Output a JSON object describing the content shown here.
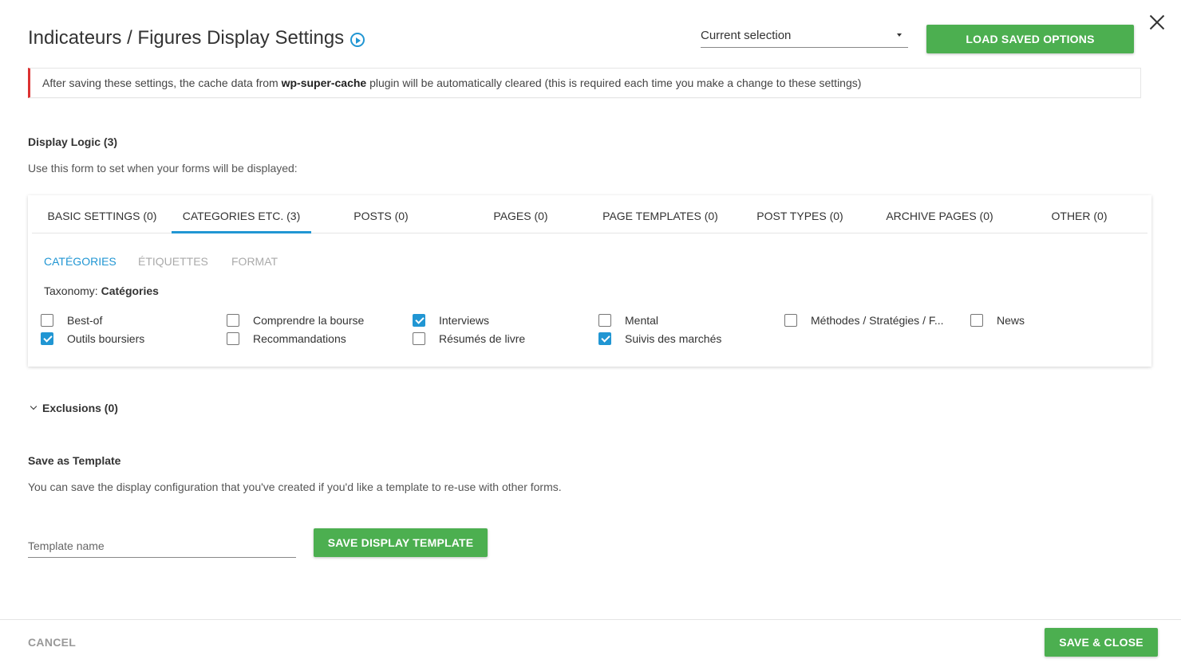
{
  "header": {
    "title": "Indicateurs / Figures Display Settings",
    "select_value": "Current selection",
    "load_label": "LOAD SAVED OPTIONS"
  },
  "notice": {
    "before": "After saving these settings, the cache data from ",
    "plugin": "wp-super-cache",
    "after": " plugin will be automatically cleared (this is required each time you make a change to these settings)"
  },
  "display_logic": {
    "heading": "Display Logic (3)",
    "description": "Use this form to set when your forms will be displayed:"
  },
  "tabs": [
    {
      "label": "BASIC SETTINGS (0)"
    },
    {
      "label": "CATEGORIES ETC. (3)"
    },
    {
      "label": "POSTS (0)"
    },
    {
      "label": "PAGES (0)"
    },
    {
      "label": "PAGE TEMPLATES (0)"
    },
    {
      "label": "POST TYPES (0)"
    },
    {
      "label": "ARCHIVE PAGES (0)"
    },
    {
      "label": "OTHER (0)"
    }
  ],
  "subtabs": [
    {
      "label": "CATÉGORIES"
    },
    {
      "label": "ÉTIQUETTES"
    },
    {
      "label": "FORMAT"
    }
  ],
  "taxonomy": {
    "prefix": "Taxonomy: ",
    "name": "Catégories"
  },
  "categories": [
    {
      "label": "Best-of",
      "checked": false
    },
    {
      "label": "Comprendre la bourse",
      "checked": false
    },
    {
      "label": "Interviews",
      "checked": true
    },
    {
      "label": "Mental",
      "checked": false
    },
    {
      "label": "Méthodes / Stratégies / F...",
      "checked": false
    },
    {
      "label": "News",
      "checked": false
    },
    {
      "label": "Outils boursiers",
      "checked": true
    },
    {
      "label": "Recommandations",
      "checked": false
    },
    {
      "label": "Résumés de livre",
      "checked": false
    },
    {
      "label": "Suivis des marchés",
      "checked": true
    }
  ],
  "exclusions": {
    "label": "Exclusions (0)"
  },
  "template": {
    "heading": "Save as Template",
    "description": "You can save the display configuration that you've created if you'd like a template to re-use with other forms.",
    "placeholder": "Template name",
    "save_label": "SAVE DISPLAY TEMPLATE"
  },
  "footer": {
    "cancel_label": "CANCEL",
    "save_close_label": "SAVE & CLOSE"
  },
  "colors": {
    "accent": "#2196d3",
    "primary_button": "#4caf50",
    "notice_border": "#dc3232"
  }
}
